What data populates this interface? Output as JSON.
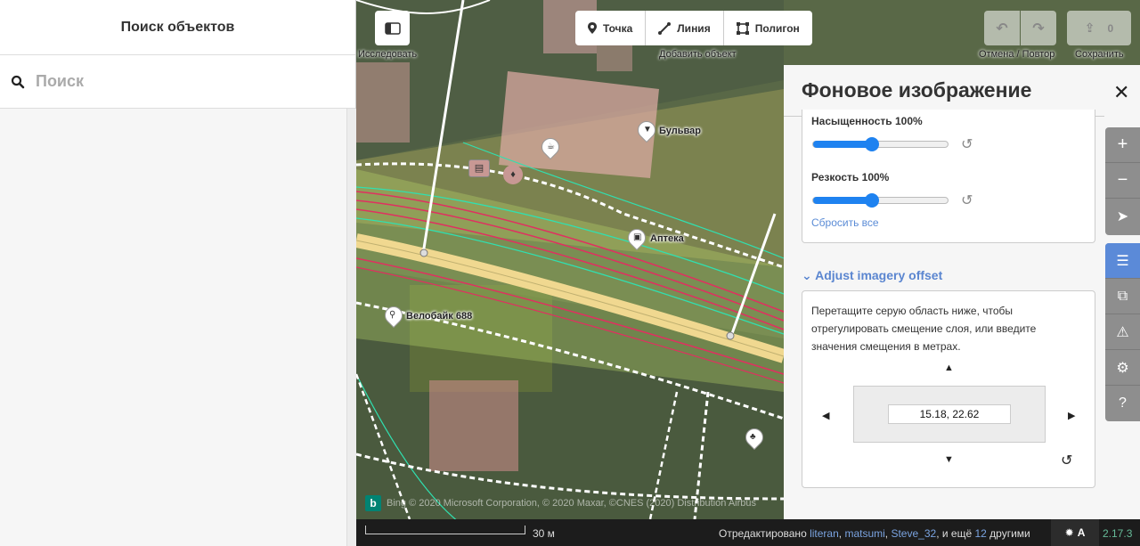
{
  "sidebar": {
    "title": "Поиск объектов",
    "search_placeholder": "Поиск"
  },
  "toolbar": {
    "explore_label": "Исследовать",
    "add_point": "Точка",
    "add_line": "Линия",
    "add_area": "Полигон",
    "add_label": "Добавить объект",
    "undo_redo_label": "Отмена / Повтор",
    "save_label": "Сохранить",
    "save_count": "0"
  },
  "map": {
    "pois": [
      "Бульвар",
      "Аптека",
      "Велобайк 688"
    ],
    "attribution": "Bing © 2020 Microsoft Corporation, © 2020 Maxar, ©CNES (2020) Distribution Airbus",
    "attribution_brand": "b"
  },
  "panel": {
    "title": "Фоновое изображение",
    "saturation_label": "Насыщенность",
    "saturation_value": "100%",
    "saturation_level": 0.44,
    "sharpness_label": "Резкость",
    "sharpness_value": "100%",
    "sharpness_level": 0.44,
    "reset_all": "Сбросить все",
    "offset_section_title": "Adjust imagery offset",
    "offset_description": "Перетащите серую область ниже, чтобы отрегулировать смещение слоя, или введите значения смещения в метрах.",
    "offset_value": "15.18, 22.62"
  },
  "rail": {
    "icons": [
      "zoom-in-icon",
      "zoom-out-icon",
      "geolocate-icon",
      "background-layers-icon",
      "map-data-icon",
      "issues-icon",
      "preferences-icon",
      "help-icon"
    ]
  },
  "footer": {
    "scale": "30 м",
    "edited_by_prefix": "Отредактировано",
    "editors": [
      "literan",
      "matsumi",
      "Steve_32"
    ],
    "edited_by_suffix_1": ", и ещё",
    "more_count": "12",
    "edited_by_suffix_2": "другими",
    "issues_label": "A",
    "version": "2.17.3"
  },
  "colors": {
    "accent": "#1e82f0",
    "link": "#5b86d0",
    "footer_bg": "#1c1c1c"
  }
}
